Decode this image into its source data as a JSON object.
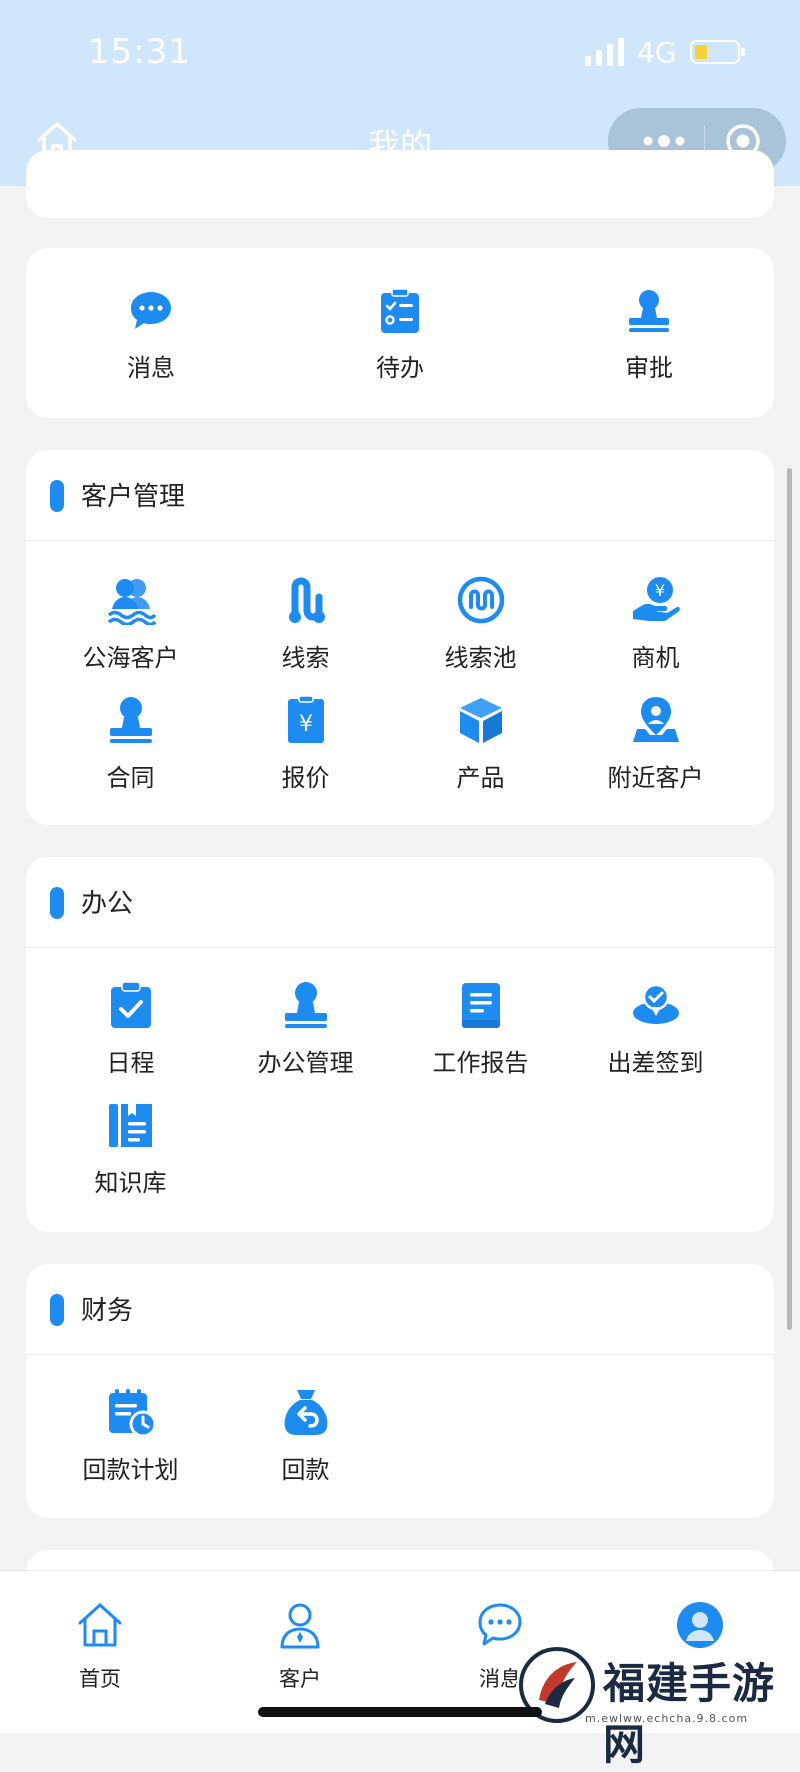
{
  "status_bar": {
    "time": "15:31",
    "network": "4G"
  },
  "nav": {
    "title": "我的"
  },
  "quick_actions": [
    {
      "label": "消息",
      "icon": "message-bubble-icon"
    },
    {
      "label": "待办",
      "icon": "checklist-clipboard-icon"
    },
    {
      "label": "审批",
      "icon": "approval-stamp-icon"
    }
  ],
  "sections": [
    {
      "title": "客户管理",
      "items": [
        {
          "label": "公海客户",
          "icon": "customer-pool-icon"
        },
        {
          "label": "线索",
          "icon": "leads-icon"
        },
        {
          "label": "线索池",
          "icon": "lead-pool-icon"
        },
        {
          "label": "商机",
          "icon": "opportunity-icon"
        },
        {
          "label": "合同",
          "icon": "contract-stamp-icon"
        },
        {
          "label": "报价",
          "icon": "quote-yen-icon"
        },
        {
          "label": "产品",
          "icon": "product-box-icon"
        },
        {
          "label": "附近客户",
          "icon": "nearby-location-icon"
        }
      ]
    },
    {
      "title": "办公",
      "items": [
        {
          "label": "日程",
          "icon": "schedule-clipboard-icon"
        },
        {
          "label": "办公管理",
          "icon": "office-stamp-icon"
        },
        {
          "label": "工作报告",
          "icon": "report-book-icon"
        },
        {
          "label": "出差签到",
          "icon": "checkin-location-icon"
        },
        {
          "label": "知识库",
          "icon": "knowledge-book-icon"
        }
      ]
    },
    {
      "title": "财务",
      "items": [
        {
          "label": "回款计划",
          "icon": "payment-plan-icon"
        },
        {
          "label": "回款",
          "icon": "payment-bag-icon"
        }
      ]
    }
  ],
  "tabbar": [
    {
      "label": "首页",
      "icon": "home-icon"
    },
    {
      "label": "客户",
      "icon": "customer-icon"
    },
    {
      "label": "消息",
      "icon": "message-icon"
    },
    {
      "label": "",
      "icon": "my-icon"
    }
  ],
  "watermark": {
    "text": "福建手游网",
    "url": "m.ewlww.echcha.9.8.com"
  },
  "colors": {
    "accent": "#1d8bf0",
    "navbar": "#cfe6fb",
    "background": "#f2f3f5"
  }
}
